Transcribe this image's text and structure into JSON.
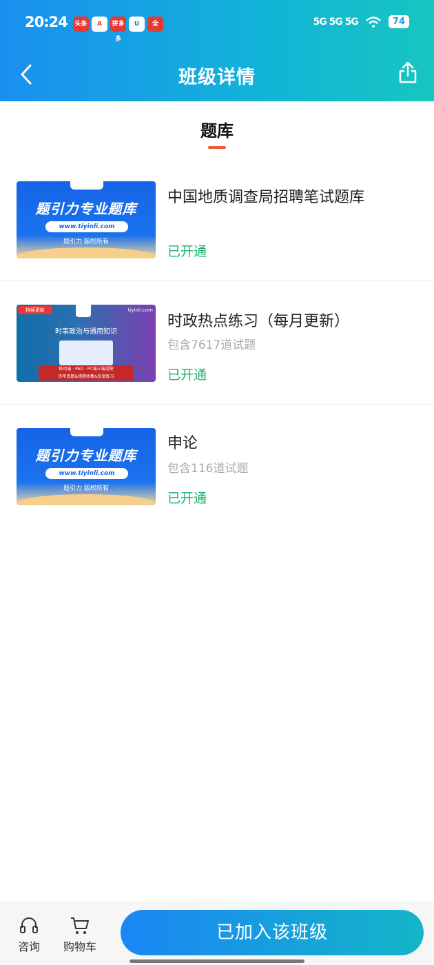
{
  "status_bar": {
    "time": "20:24",
    "apps": [
      "头条",
      "A",
      "拼多多",
      "U",
      "全"
    ],
    "signal": "5G 5G 5G",
    "battery": "74"
  },
  "nav": {
    "title": "班级详情"
  },
  "section": {
    "title": "题库"
  },
  "thumbs": {
    "brand_main": "题引力专业题库",
    "brand_url": "www.tiyinli.com",
    "brand_copyright": "题引力 版权所有",
    "purple_badge": "持续更新",
    "purple_site": "tiyinli.com",
    "purple_title": "时事政治与通用知识",
    "purple_footer_1": "移动端 · PAD · PC端三端适配",
    "purple_footer_2": "历年真题&错题收集&反复练习"
  },
  "items": [
    {
      "title": "中国地质调查局招聘笔试题库",
      "count": "",
      "status": "已开通"
    },
    {
      "title": "时政热点练习（每月更新）",
      "count": "包含7617道试题",
      "status": "已开通"
    },
    {
      "title": "申论",
      "count": "包含116道试题",
      "status": "已开通"
    }
  ],
  "bottom_bar": {
    "consult_label": "咨询",
    "cart_label": "购物车",
    "cta_label": "已加入该班级"
  },
  "colors": {
    "header_start": "#1a8ff0",
    "header_end": "#16c6c0",
    "status_green": "#19b36b",
    "underline": "#f05a3c"
  }
}
